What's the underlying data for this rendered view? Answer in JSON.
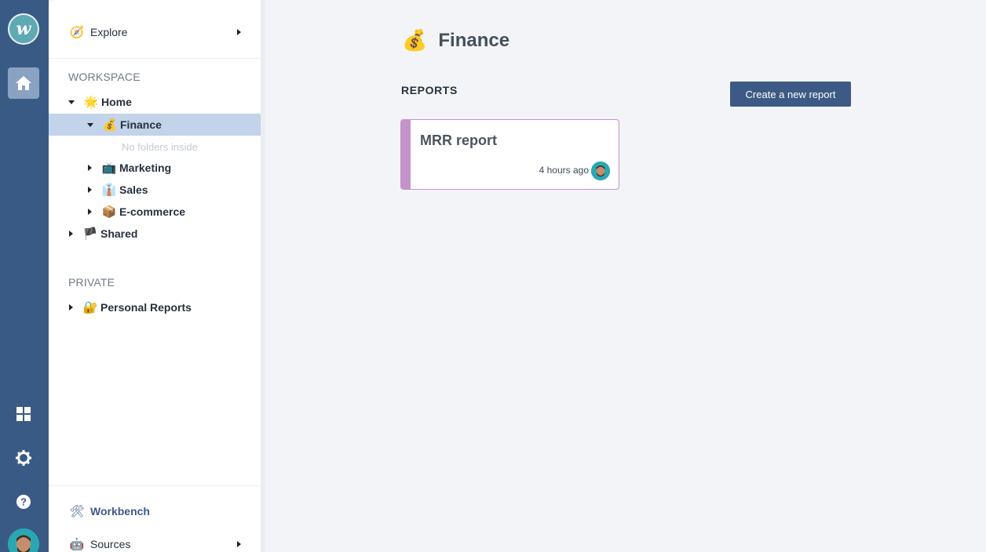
{
  "rail": {
    "logo_letter": "w",
    "items": [
      {
        "name": "home-icon"
      },
      {
        "name": "dashboard-icon"
      },
      {
        "name": "settings-icon"
      },
      {
        "name": "help-icon"
      }
    ]
  },
  "sidebar": {
    "explore": {
      "emoji": "🧭",
      "label": "Explore"
    },
    "workspace_heading": "WORKSPACE",
    "tree": {
      "home": {
        "emoji": "🌟",
        "label": "Home"
      },
      "finance": {
        "emoji": "💰",
        "label": "Finance",
        "empty_note": "No folders inside"
      },
      "marketing": {
        "emoji": "📺",
        "label": "Marketing"
      },
      "sales": {
        "emoji": "👔",
        "label": "Sales"
      },
      "ecommerce": {
        "emoji": "📦",
        "label": "E-commerce"
      },
      "shared": {
        "emoji": "🏴",
        "label": "Shared"
      }
    },
    "private_heading": "PRIVATE",
    "personal": {
      "emoji": "🔐",
      "label": "Personal Reports"
    },
    "workbench": {
      "emoji": "🛠",
      "label": "Workbench"
    },
    "sources": {
      "emoji": "🤖",
      "label": "Sources"
    }
  },
  "main": {
    "title_emoji": "💰",
    "title": "Finance",
    "reports_label": "REPORTS",
    "create_button": "Create a new report",
    "cards": [
      {
        "title": "MRR report",
        "time": "4 hours ago"
      }
    ]
  },
  "colors": {
    "rail": "#3a5a86",
    "selected_row": "#c2d3ea",
    "button": "#3c5a85",
    "card_accent": "#c493c9"
  }
}
